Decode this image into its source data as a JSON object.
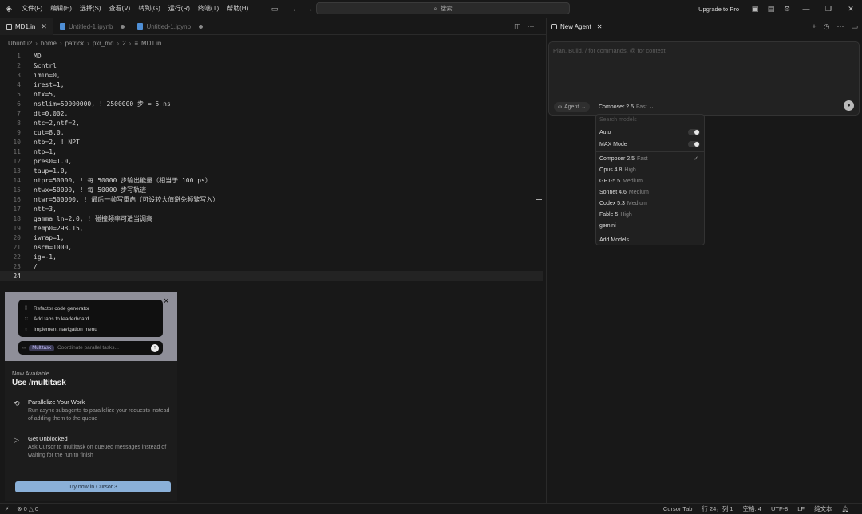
{
  "menu": [
    "文件(F)",
    "编辑(E)",
    "选择(S)",
    "查看(V)",
    "转到(G)",
    "运行(R)",
    "终端(T)",
    "帮助(H)"
  ],
  "search": {
    "label": "搜索"
  },
  "upgrade_label": "Upgrade to Pro",
  "tabs": [
    {
      "label": "MD1.in",
      "active": true
    },
    {
      "label": "Untitled-1.ipynb",
      "active": false
    },
    {
      "label": "Untitled-1.ipynb",
      "active": false
    }
  ],
  "breadcrumb": [
    "Ubuntu2",
    "home",
    "patrick",
    "pxr_md",
    "2",
    "MD1.in"
  ],
  "editor": {
    "current_line": 24,
    "lines": [
      "MD",
      "&cntrl",
      "imin=0,",
      "irest=1,",
      "ntx=5,",
      "nstlim=50000000, ! 2500000 步 = 5 ns",
      "dt=0.002,",
      "ntc=2,ntf=2,",
      "cut=8.0,",
      "ntb=2, ! NPT",
      "ntp=1,",
      "pres0=1.0,",
      "taup=1.0,",
      "ntpr=50000, ! 每 50000 步输出能量（相当于 100 ps）",
      "ntwx=50000, ! 每 50000 步写轨迹",
      "ntwr=500000, ! 最后一帧写重启（可设较大值避免频繁写入）",
      "ntt=3,",
      "gamma_ln=2.0, ! 碰撞频率可适当调高",
      "temp0=298.15,",
      "iwrap=1,",
      "nscm=1000,",
      "ig=-1,",
      "/",
      ""
    ]
  },
  "promo": {
    "card_items": [
      "Refactor code generator",
      "Add tabs to leaderboard",
      "Implement navigation menu"
    ],
    "chip": "Multitask",
    "input_placeholder": "Coordinate parallel tasks...",
    "now_available": "Now Available",
    "title": "Use /multitask",
    "features": [
      {
        "title": "Parallelize Your Work",
        "desc": "Run async subagents to parallelize your requests instead of adding them to the queue"
      },
      {
        "title": "Get Unblocked",
        "desc": "Ask Cursor to multitask on queued messages instead of waiting for the run to finish"
      }
    ],
    "button": "Try now in Cursor 3"
  },
  "agent": {
    "tab_label": "New Agent",
    "placeholder": "Plan, Build, / for commands, @ for context",
    "mode": "Agent",
    "model": "Composer 2.5",
    "model_speed": "Fast"
  },
  "model_dropdown": {
    "search_placeholder": "Search models",
    "toggles": [
      {
        "label": "Auto",
        "on": false
      },
      {
        "label": "MAX Mode",
        "on": false
      }
    ],
    "models": [
      {
        "name": "Composer 2.5",
        "sub": "Fast",
        "selected": true
      },
      {
        "name": "Opus 4.8",
        "sub": "High",
        "selected": false
      },
      {
        "name": "GPT-5.5",
        "sub": "Medium",
        "selected": false
      },
      {
        "name": "Sonnet 4.6",
        "sub": "Medium",
        "selected": false
      },
      {
        "name": "Codex 5.3",
        "sub": "Medium",
        "selected": false
      },
      {
        "name": "Fable 5",
        "sub": "High",
        "selected": false
      },
      {
        "name": "gemini",
        "sub": "",
        "selected": false
      }
    ],
    "add_label": "Add Models"
  },
  "status": {
    "errors": "0",
    "warnings": "0",
    "cursor_tab": "Cursor Tab",
    "position": "行 24，列 1",
    "spaces": "空格: 4",
    "encoding": "UTF-8",
    "eol": "LF",
    "language": "纯文本"
  }
}
